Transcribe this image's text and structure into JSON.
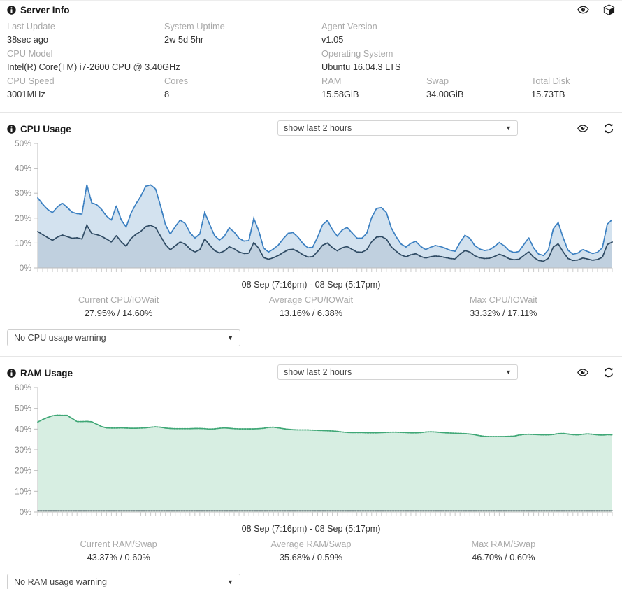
{
  "server_info": {
    "title": "Server Info",
    "icons": [
      "eye-icon",
      "cube-icon"
    ],
    "fields": [
      {
        "label": "Last Update",
        "value": "38sec ago"
      },
      {
        "label": "System Uptime",
        "value": "2w 5d 5hr"
      },
      {
        "label": "Agent Version",
        "value": "v1.05"
      },
      {
        "label": "CPU Model",
        "value": "Intel(R) Core(TM) i7-2600 CPU @ 3.40GHz"
      },
      {
        "label": "Operating System",
        "value": "Ubuntu 16.04.3 LTS"
      },
      {
        "label": "CPU Speed",
        "value": "3001MHz"
      },
      {
        "label": "Cores",
        "value": "8"
      },
      {
        "label": "RAM",
        "value": "15.58GiB"
      },
      {
        "label": "Swap",
        "value": "34.00GiB"
      },
      {
        "label": "Total Disk",
        "value": "15.73TB"
      }
    ]
  },
  "cpu": {
    "title": "CPU Usage",
    "range_label": "show last 2 hours",
    "warning_label": "No CPU usage warning",
    "icons": [
      "eye-icon",
      "refresh-icon"
    ],
    "stats": [
      {
        "label": "Current CPU/IOWait",
        "value": "27.95% / 14.60%"
      },
      {
        "label": "Average CPU/IOWait",
        "value": "13.16% / 6.38%"
      },
      {
        "label": "Max CPU/IOWait",
        "value": "33.32% / 17.11%"
      }
    ]
  },
  "ram": {
    "title": "RAM Usage",
    "range_label": "show last 2 hours",
    "warning_label": "No RAM usage warning",
    "icons": [
      "eye-icon",
      "refresh-icon"
    ],
    "stats": [
      {
        "label": "Current RAM/Swap",
        "value": "43.37% / 0.60%"
      },
      {
        "label": "Average RAM/Swap",
        "value": "35.68% / 0.59%"
      },
      {
        "label": "Max RAM/Swap",
        "value": "46.70% / 0.60%"
      }
    ]
  },
  "colors": {
    "cpu_line": "#3a7fc1",
    "cpu_fill": "#d3e2ef",
    "iowait_line": "#2e4a63",
    "iowait_fill": "#c0d0df",
    "ram_line": "#3fa776",
    "ram_fill": "#d7eee2",
    "swap_line": "#4a5a63",
    "label_gray": "#a9a9a9",
    "axis_gray": "#bdbdbd"
  },
  "chart_data": [
    {
      "type": "area",
      "title": "CPU Usage",
      "xlabel": "08 Sep (7:16pm) - 08 Sep (5:17pm)",
      "ylabel": "",
      "ylim": [
        0,
        50
      ],
      "yticks": [
        "0%",
        "10%",
        "20%",
        "30%",
        "40%",
        "50%"
      ],
      "ytick_values": [
        0,
        10,
        20,
        30,
        40,
        50
      ],
      "grid": false,
      "legend": "none",
      "x_range_label": "08 Sep (7:16pm) - 08 Sep (5:17pm)",
      "series": [
        {
          "name": "CPU",
          "color": "#3a7fc1",
          "fill": "#d3e2ef",
          "values": [
            28.1,
            25.6,
            23.5,
            22.2,
            24.5,
            26.0,
            24.3,
            22.4,
            21.8,
            21.6,
            33.4,
            26.1,
            25.4,
            23.5,
            20.8,
            19.2,
            24.9,
            19.3,
            16.4,
            22.0,
            25.7,
            28.8,
            32.8,
            33.3,
            31.7,
            25.0,
            17.4,
            13.6,
            16.6,
            19.2,
            17.9,
            14.2,
            12.0,
            13.6,
            22.3,
            17.5,
            13.0,
            11.2,
            12.7,
            16.1,
            14.4,
            11.9,
            10.8,
            11.0,
            19.9,
            15.0,
            8.0,
            6.4,
            7.6,
            9.2,
            11.7,
            13.9,
            14.2,
            12.4,
            9.8,
            8.1,
            8.3,
            12.4,
            17.3,
            19.1,
            15.4,
            12.8,
            15.2,
            16.3,
            14.1,
            12.0,
            11.9,
            13.9,
            20.2,
            23.9,
            24.2,
            22.3,
            16.1,
            12.5,
            9.6,
            8.4,
            9.9,
            10.7,
            8.6,
            7.4,
            8.3,
            9.0,
            8.6,
            7.9,
            7.1,
            6.7,
            10.2,
            13.1,
            11.9,
            9.0,
            7.6,
            7.0,
            7.3,
            8.6,
            10.2,
            8.9,
            6.9,
            6.2,
            6.6,
            9.4,
            12.1,
            8.0,
            5.6,
            5.0,
            7.3,
            15.7,
            18.2,
            12.2,
            7.1,
            5.5,
            6.0,
            7.4,
            6.6,
            5.8,
            6.3,
            8.1,
            17.6,
            19.4
          ]
        },
        {
          "name": "IOWait",
          "color": "#2e4a63",
          "fill": "#c0d0df",
          "values": [
            14.6,
            13.4,
            12.2,
            11.1,
            12.4,
            13.2,
            12.6,
            11.9,
            12.1,
            11.6,
            17.2,
            13.8,
            13.4,
            12.7,
            11.6,
            10.4,
            13.0,
            10.5,
            8.7,
            11.8,
            13.5,
            14.7,
            16.6,
            17.1,
            16.2,
            12.8,
            9.4,
            7.3,
            8.9,
            10.4,
            9.6,
            7.6,
            6.4,
            7.3,
            11.6,
            9.2,
            7.0,
            6.0,
            6.8,
            8.5,
            7.7,
            6.4,
            5.8,
            5.9,
            10.2,
            7.9,
            4.2,
            3.5,
            4.1,
            5.0,
            6.2,
            7.3,
            7.5,
            6.6,
            5.3,
            4.4,
            4.5,
            6.6,
            9.1,
            10.0,
            8.2,
            6.9,
            8.1,
            8.6,
            7.5,
            6.4,
            6.3,
            7.3,
            10.5,
            12.4,
            12.6,
            11.6,
            8.5,
            6.7,
            5.2,
            4.5,
            5.3,
            5.7,
            4.6,
            4.0,
            4.5,
            4.8,
            4.6,
            4.2,
            3.8,
            3.6,
            5.5,
            7.0,
            6.4,
            4.9,
            4.1,
            3.8,
            3.9,
            4.6,
            5.5,
            4.8,
            3.7,
            3.3,
            3.5,
            5.0,
            6.5,
            4.3,
            3.0,
            2.7,
            3.9,
            8.4,
            9.7,
            6.5,
            3.8,
            3.0,
            3.2,
            4.0,
            3.6,
            3.1,
            3.4,
            4.3,
            9.4,
            10.4
          ]
        }
      ]
    },
    {
      "type": "area",
      "title": "RAM Usage",
      "xlabel": "08 Sep (7:16pm) - 08 Sep (5:17pm)",
      "ylabel": "",
      "ylim": [
        0,
        60
      ],
      "yticks": [
        "0%",
        "10%",
        "20%",
        "30%",
        "40%",
        "50%",
        "60%"
      ],
      "ytick_values": [
        0,
        10,
        20,
        30,
        40,
        50,
        60
      ],
      "grid": false,
      "legend": "none",
      "x_range_label": "08 Sep (7:16pm) - 08 Sep (5:17pm)",
      "series": [
        {
          "name": "RAM",
          "color": "#3fa776",
          "fill": "#d7eee2",
          "values": [
            43.4,
            44.6,
            45.6,
            46.4,
            46.7,
            46.6,
            46.6,
            45.1,
            43.6,
            43.6,
            43.7,
            43.5,
            42.4,
            41.2,
            40.6,
            40.5,
            40.5,
            40.6,
            40.5,
            40.4,
            40.4,
            40.5,
            40.6,
            40.9,
            41.1,
            40.9,
            40.5,
            40.3,
            40.2,
            40.2,
            40.2,
            40.2,
            40.3,
            40.3,
            40.2,
            40.0,
            40.1,
            40.4,
            40.6,
            40.4,
            40.2,
            40.1,
            40.1,
            40.1,
            40.1,
            40.2,
            40.4,
            40.8,
            40.9,
            40.6,
            40.2,
            39.9,
            39.7,
            39.6,
            39.6,
            39.6,
            39.5,
            39.4,
            39.3,
            39.2,
            39.1,
            38.9,
            38.6,
            38.4,
            38.3,
            38.3,
            38.3,
            38.2,
            38.2,
            38.2,
            38.3,
            38.4,
            38.5,
            38.5,
            38.4,
            38.3,
            38.2,
            38.2,
            38.3,
            38.6,
            38.7,
            38.6,
            38.4,
            38.2,
            38.1,
            38.0,
            37.9,
            37.8,
            37.6,
            37.3,
            36.8,
            36.5,
            36.4,
            36.4,
            36.4,
            36.4,
            36.5,
            36.6,
            37.1,
            37.4,
            37.5,
            37.4,
            37.3,
            37.2,
            37.2,
            37.4,
            37.8,
            37.9,
            37.6,
            37.3,
            37.2,
            37.5,
            37.7,
            37.5,
            37.2,
            37.1,
            37.3,
            37.2
          ]
        },
        {
          "name": "Swap",
          "color": "#4a5a63",
          "fill": "none",
          "values": [
            0.6,
            0.6,
            0.6,
            0.6,
            0.6,
            0.6,
            0.6,
            0.6,
            0.6,
            0.6,
            0.6,
            0.6,
            0.6,
            0.6,
            0.6,
            0.6,
            0.6,
            0.6,
            0.6,
            0.6,
            0.6,
            0.6,
            0.6,
            0.6,
            0.6,
            0.6,
            0.6,
            0.6,
            0.6,
            0.6,
            0.59,
            0.59,
            0.59,
            0.59,
            0.59,
            0.59,
            0.59,
            0.59,
            0.59,
            0.59,
            0.59,
            0.59,
            0.59,
            0.59,
            0.59,
            0.59,
            0.59,
            0.59,
            0.59,
            0.59,
            0.59,
            0.59,
            0.59,
            0.59,
            0.59,
            0.59,
            0.59,
            0.59,
            0.59,
            0.59,
            0.59,
            0.59,
            0.59,
            0.59,
            0.59,
            0.59,
            0.59,
            0.59,
            0.59,
            0.59,
            0.59,
            0.59,
            0.59,
            0.59,
            0.59,
            0.59,
            0.59,
            0.59,
            0.59,
            0.59,
            0.59,
            0.59,
            0.59,
            0.59,
            0.59,
            0.59,
            0.59,
            0.59,
            0.59,
            0.59,
            0.59,
            0.59,
            0.59,
            0.59,
            0.59,
            0.59,
            0.59,
            0.59,
            0.59,
            0.59,
            0.59,
            0.59,
            0.59,
            0.59,
            0.59,
            0.59,
            0.59,
            0.59,
            0.6,
            0.6,
            0.6,
            0.6,
            0.6,
            0.6,
            0.6,
            0.6,
            0.6,
            0.6
          ]
        }
      ]
    }
  ]
}
